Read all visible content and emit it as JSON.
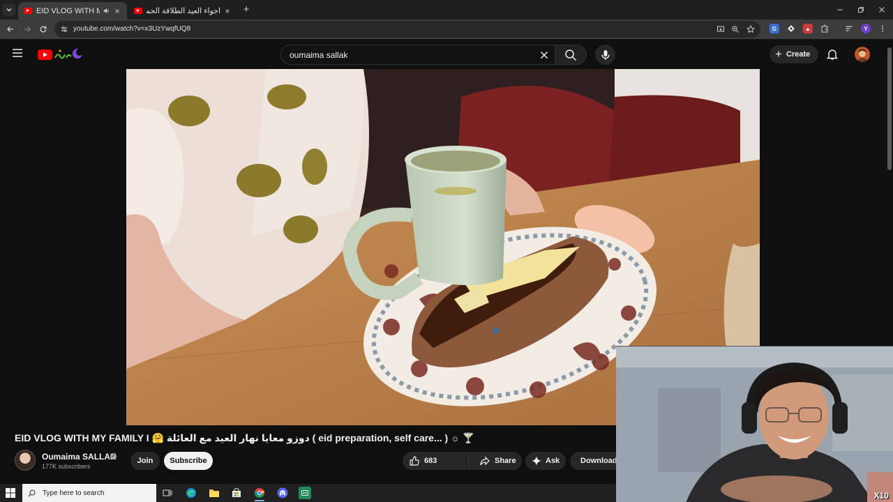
{
  "browser": {
    "tabs": [
      {
        "title": "EID VLOG WITH MY FAMILY",
        "active": true
      },
      {
        "title": "اجواء العيد الطلاقة الحمام السوق",
        "active": false
      }
    ],
    "url": "youtube.com/watch?v=x3UzYwqfUQ8"
  },
  "youtube": {
    "search_query": "oumaima sallak",
    "create_label": "Create",
    "video": {
      "title": "EID VLOG WITH MY FAMILY I 🤗 دوزو معايا نهار العيد مع العائلة ( eid preparation, self care... ) ☼ 🍸",
      "channel": "Oumaima SALLAK",
      "subscribers": "177K subscribers",
      "join_label": "Join",
      "subscribe_label": "Subscribe",
      "likes": "683",
      "share_label": "Share",
      "ask_label": "Ask",
      "download_label": "Download"
    }
  },
  "webcam": {
    "badge": "X10"
  },
  "taskbar": {
    "search_placeholder": "Type here to search"
  },
  "colors": {
    "yt_red": "#ff0000",
    "background": "#0f0f0f",
    "chip": "#272727"
  }
}
